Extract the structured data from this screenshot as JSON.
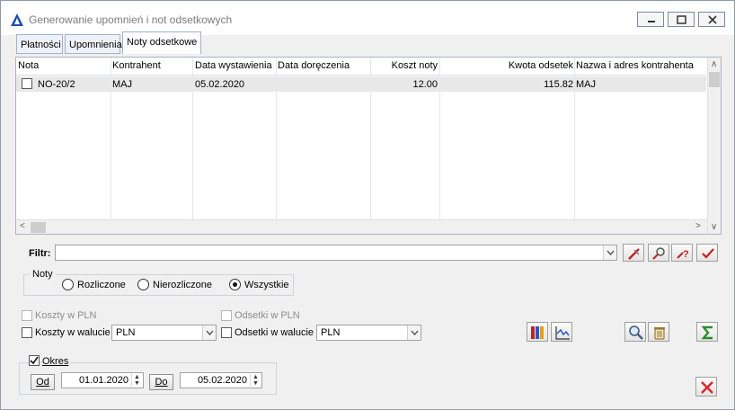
{
  "window": {
    "title": "Generowanie upomnień i not odsetkowych"
  },
  "tabs": [
    {
      "label": "Płatności"
    },
    {
      "label": "Upomnienia"
    },
    {
      "label": "Noty odsetkowe"
    }
  ],
  "grid": {
    "columns": [
      "Nota",
      "Kontrahent",
      "Data wystawienia",
      "Data doręczenia",
      "Koszt noty",
      "Kwota odsetek",
      "Nazwa i adres kontrahenta"
    ],
    "rows": [
      {
        "checked": false,
        "nota": "NO-20/2",
        "kontrahent": "MAJ",
        "data_wystawienia": "05.02.2020",
        "data_doreczenia": "",
        "koszt_noty": "12.00",
        "kwota_odsetek": "115.82",
        "nazwa_adres": "MAJ"
      }
    ]
  },
  "filter": {
    "label": "Filtr:",
    "value": ""
  },
  "noty_group": {
    "legend": "Noty",
    "options": [
      "Rozliczone",
      "Nierozliczone",
      "Wszystkie"
    ],
    "selected": "Wszystkie"
  },
  "costs": {
    "koszty_pln_label": "Koszty w PLN",
    "koszty_waluta_label": "Koszty w walucie",
    "koszty_waluta_value": "PLN",
    "odsetki_pln_label": "Odsetki w PLN",
    "odsetki_waluta_label": "Odsetki w walucie",
    "odsetki_waluta_value": "PLN"
  },
  "okres": {
    "label": "Okres",
    "checked": true,
    "od_label": "Od",
    "od_value": "01.01.2020",
    "do_label": "Do",
    "do_value": "05.02.2020"
  },
  "icons": {
    "app": "triangle-logo-icon",
    "filter_clear": "eraser-icon",
    "filter_search": "magnifier-wrench-icon",
    "filter_help": "question-icon",
    "filter_apply": "checkmark-icon",
    "books": "books-icon",
    "chart": "chart-icon",
    "search": "search-icon",
    "trash": "trash-icon",
    "sum": "sigma-icon",
    "close": "close-icon"
  },
  "colors": {
    "accent_red": "#d62828",
    "accent_green": "#2e8b2e",
    "app_blue": "#1f4fa8"
  }
}
